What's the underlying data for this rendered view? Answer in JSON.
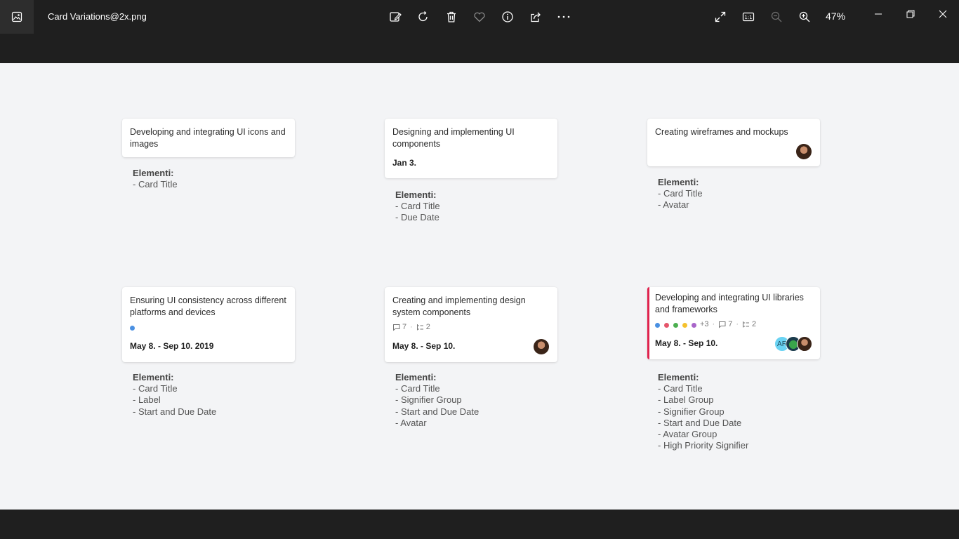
{
  "window": {
    "filename": "Card Variations@2x.png",
    "zoom": "47%",
    "icons": {
      "app": "photos-app-icon",
      "edit": "edit-image-icon",
      "rotate": "rotate-icon",
      "delete": "delete-icon",
      "favorite": "heart-icon",
      "info": "info-icon",
      "share": "share-icon",
      "more": "more-icon",
      "fullscreen": "fullscreen-icon",
      "actual_size": "actual-size-icon",
      "zoom_out": "zoom-out-icon",
      "zoom_in": "zoom-in-icon",
      "minimize": "minimize-icon",
      "restore": "restore-icon",
      "close": "close-icon"
    },
    "actual_size_label": "1:1"
  },
  "cards": [
    {
      "title": "Developing and integrating UI icons and images"
    },
    {
      "title": "Designing and implementing UI components",
      "date": "Jan 3."
    },
    {
      "title": "Creating wireframes and mockups"
    },
    {
      "title": "Ensuring UI consistency across different platforms and devices",
      "label_color": "#4a90e2",
      "date": "May 8. - Sep 10. 2019"
    },
    {
      "title": "Creating and implementing design system components",
      "comments": "7",
      "subtasks": "2",
      "date": "May 8. - Sep 10."
    },
    {
      "title": "Developing and integrating UI libraries and frameworks",
      "labels": [
        "#4a90e2",
        "#e5566b",
        "#4caf50",
        "#f5c12e",
        "#a865c9"
      ],
      "more_labels": "+3",
      "comments": "7",
      "subtasks": "2",
      "date": "May 8. - Sep 10.",
      "avatar_initials": "AR",
      "priority_color": "#e0234e"
    }
  ],
  "notes": [
    {
      "heading": "Elementi:",
      "items": [
        "- Card Title"
      ]
    },
    {
      "heading": "Elementi:",
      "items": [
        "- Card Title",
        "- Due Date"
      ]
    },
    {
      "heading": "Elementi:",
      "items": [
        "- Card Title",
        "- Avatar"
      ]
    },
    {
      "heading": "Elementi:",
      "items": [
        "- Card Title",
        "- Label",
        "- Start and Due Date"
      ]
    },
    {
      "heading": "Elementi:",
      "items": [
        "- Card Title",
        "- Signifier Group",
        "- Start and Due Date",
        "- Avatar"
      ]
    },
    {
      "heading": "Elementi:",
      "items": [
        "- Card Title",
        "- Label Group",
        "- Signifier Group",
        "- Start and Due Date",
        "- Avatar Group",
        "- High Priority Signifier"
      ]
    }
  ]
}
